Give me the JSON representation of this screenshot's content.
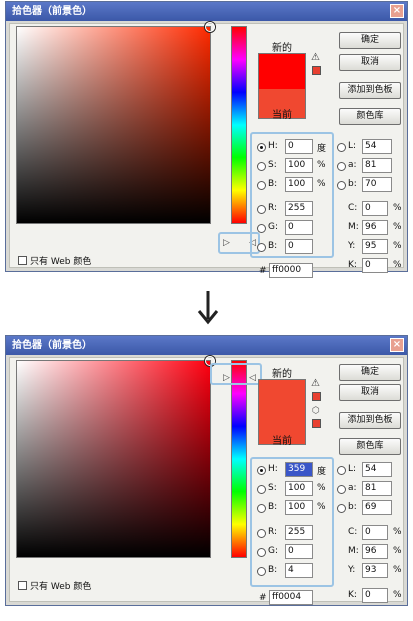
{
  "arrow_icon": "down-arrow-icon",
  "dialogs": [
    {
      "title": "拾色器（前景色）",
      "close_label": "×",
      "new_label": "新的",
      "current_label": "当前",
      "new_color": "#ff0000",
      "current_color": "#f04830",
      "buttons": {
        "ok": "确定",
        "cancel": "取消",
        "add_swatch": "添加到色板",
        "libraries": "颜色库"
      },
      "hsb": {
        "h_label": "H:",
        "h": "0",
        "h_unit": "度",
        "s_label": "S:",
        "s": "100",
        "s_unit": "%",
        "b_label": "B:",
        "b": "100",
        "b_unit": "%"
      },
      "rgb": {
        "r_label": "R:",
        "r": "255",
        "g_label": "G:",
        "g": "0",
        "b_label": "B:",
        "b": "0"
      },
      "lab": {
        "l_label": "L:",
        "l": "54",
        "a_label": "a:",
        "a": "81",
        "b_label": "b:",
        "b": "70"
      },
      "cmyk": {
        "c_label": "C:",
        "c": "0",
        "c_unit": "%",
        "m_label": "M:",
        "m": "96",
        "m_unit": "%",
        "y_label": "Y:",
        "y": "95",
        "y_unit": "%",
        "k_label": "K:",
        "k": "0",
        "k_unit": "%"
      },
      "hex_label": "#",
      "hex": "ff0000",
      "web_colors_label": "只有 Web 颜色",
      "field_hue_color": "#ff2a00",
      "selected_radio": "h",
      "h_selected": false
    },
    {
      "title": "拾色器（前景色）",
      "close_label": "×",
      "new_label": "新的",
      "current_label": "当前",
      "new_color": "#f04830",
      "current_color": "#f04830",
      "buttons": {
        "ok": "确定",
        "cancel": "取消",
        "add_swatch": "添加到色板",
        "libraries": "颜色库"
      },
      "hsb": {
        "h_label": "H:",
        "h": "359",
        "h_unit": "度",
        "s_label": "S:",
        "s": "100",
        "s_unit": "%",
        "b_label": "B:",
        "b": "100",
        "b_unit": "%"
      },
      "rgb": {
        "r_label": "R:",
        "r": "255",
        "g_label": "G:",
        "g": "0",
        "b_label": "B:",
        "b": "4"
      },
      "lab": {
        "l_label": "L:",
        "l": "54",
        "a_label": "a:",
        "a": "81",
        "b_label": "b:",
        "b": "69"
      },
      "cmyk": {
        "c_label": "C:",
        "c": "0",
        "c_unit": "%",
        "m_label": "M:",
        "m": "96",
        "m_unit": "%",
        "y_label": "Y:",
        "y": "93",
        "y_unit": "%",
        "k_label": "K:",
        "k": "0",
        "k_unit": "%"
      },
      "hex_label": "#",
      "hex": "ff0004",
      "web_colors_label": "只有 Web 颜色",
      "field_hue_color": "#ff0010",
      "selected_radio": "h",
      "h_selected": true
    }
  ]
}
